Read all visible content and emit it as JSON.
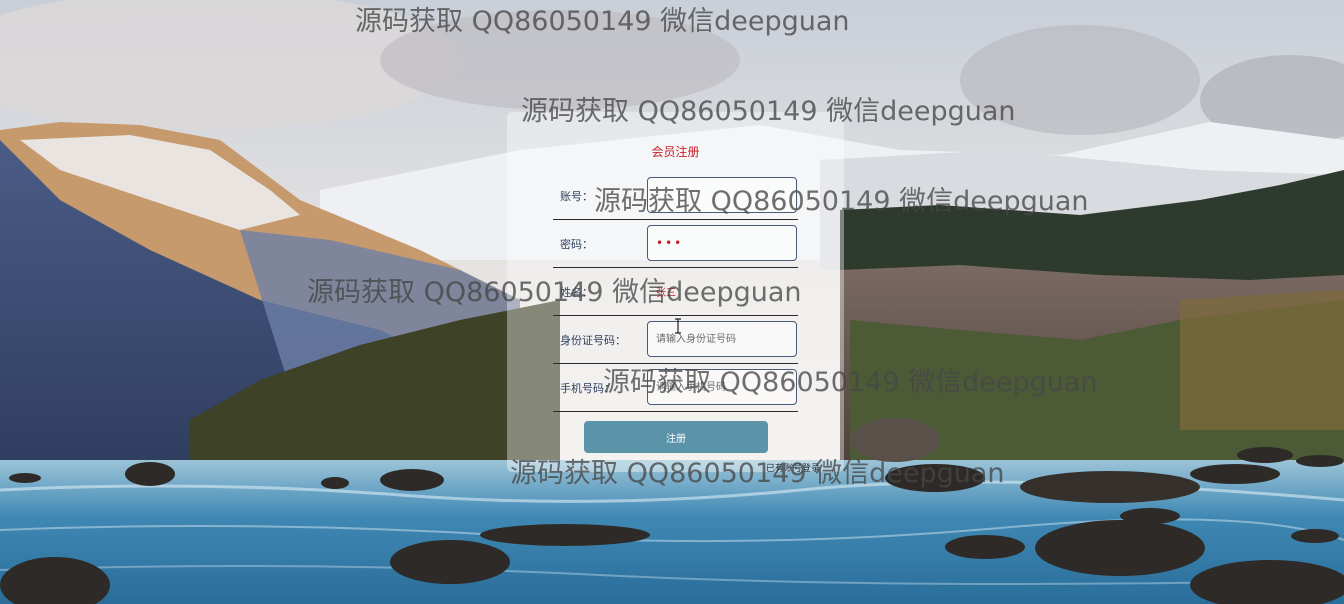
{
  "watermark_text": "源码获取 QQ86050149 微信deepguan",
  "form": {
    "title": "会员注册",
    "fields": [
      {
        "label": "账号：",
        "value": "",
        "placeholder": ""
      },
      {
        "label": "密码：",
        "value": "•••",
        "placeholder": ""
      },
      {
        "label": "姓名：",
        "value": "张三",
        "placeholder": ""
      },
      {
        "label": "身份证号码：",
        "value": "",
        "placeholder": "请输入身份证号码"
      },
      {
        "label": "手机号码：",
        "value": "",
        "placeholder": "请输入手机号码"
      }
    ],
    "submit_label": "注册",
    "login_link": "已有账号登录"
  },
  "colors": {
    "title": "#c8202a",
    "button": "#5b93a8",
    "panel": "rgba(255,255,255,0.38)"
  }
}
